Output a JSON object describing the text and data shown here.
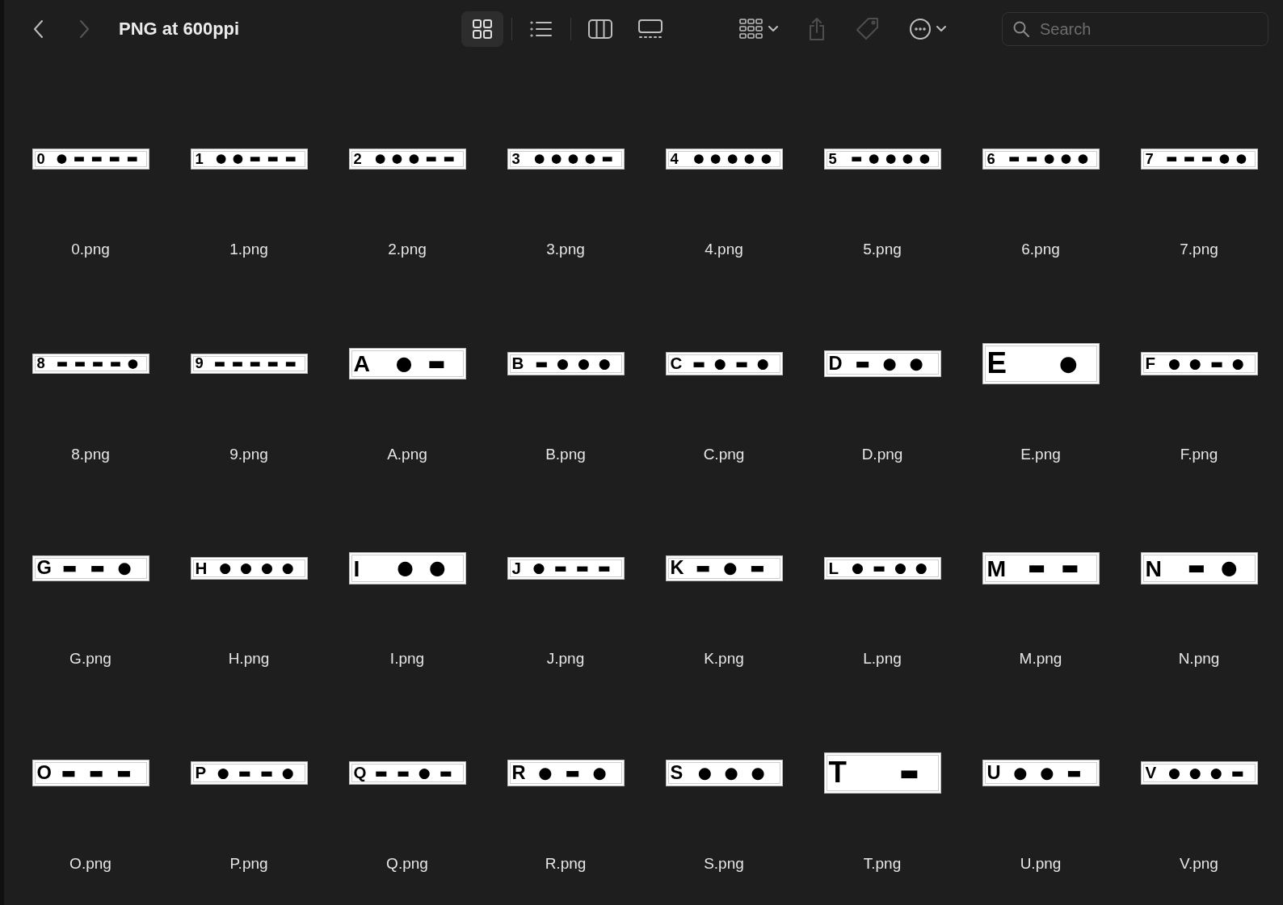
{
  "window": {
    "title": "PNG at 600ppi"
  },
  "navigation": [
    {
      "kind": "back",
      "disabled": false
    },
    {
      "kind": "forward",
      "disabled": true
    }
  ],
  "view_modes": [
    {
      "kind": "icons",
      "selected": true
    },
    {
      "kind": "list",
      "selected": false
    },
    {
      "kind": "columns",
      "selected": false
    },
    {
      "kind": "gallery",
      "selected": false
    }
  ],
  "toolbar_buttons": [
    {
      "kind": "group",
      "disabled": false
    },
    {
      "kind": "share",
      "disabled": true
    },
    {
      "kind": "tags",
      "disabled": true
    },
    {
      "kind": "more",
      "disabled": false
    }
  ],
  "search": {
    "placeholder": "Search"
  },
  "files": [
    {
      "name": "0.png",
      "thumbnail": {
        "char": "0",
        "code": "●▬▬▬▬"
      }
    },
    {
      "name": "1.png",
      "thumbnail": {
        "char": "1",
        "code": "●●▬▬▬"
      }
    },
    {
      "name": "2.png",
      "thumbnail": {
        "char": "2",
        "code": "●●●▬▬"
      }
    },
    {
      "name": "3.png",
      "thumbnail": {
        "char": "3",
        "code": "●●●●▬"
      }
    },
    {
      "name": "4.png",
      "thumbnail": {
        "char": "4",
        "code": "●●●●●"
      }
    },
    {
      "name": "5.png",
      "thumbnail": {
        "char": "5",
        "code": "▬●●●●"
      }
    },
    {
      "name": "6.png",
      "thumbnail": {
        "char": "6",
        "code": "▬▬●●●"
      }
    },
    {
      "name": "7.png",
      "thumbnail": {
        "char": "7",
        "code": "▬▬▬●●"
      }
    },
    {
      "name": "8.png",
      "thumbnail": {
        "char": "8",
        "code": "▬▬▬▬●"
      }
    },
    {
      "name": "9.png",
      "thumbnail": {
        "char": "9",
        "code": "▬▬▬▬▬"
      }
    },
    {
      "name": "A.png",
      "thumbnail": {
        "char": "A",
        "code": "●▬"
      }
    },
    {
      "name": "B.png",
      "thumbnail": {
        "char": "B",
        "code": "▬●●●"
      }
    },
    {
      "name": "C.png",
      "thumbnail": {
        "char": "C",
        "code": "▬●▬●"
      }
    },
    {
      "name": "D.png",
      "thumbnail": {
        "char": "D",
        "code": "▬●●"
      }
    },
    {
      "name": "E.png",
      "thumbnail": {
        "char": "E",
        "code": "●"
      }
    },
    {
      "name": "F.png",
      "thumbnail": {
        "char": "F",
        "code": "●●▬●"
      }
    },
    {
      "name": "G.png",
      "thumbnail": {
        "char": "G",
        "code": "▬▬●"
      }
    },
    {
      "name": "H.png",
      "thumbnail": {
        "char": "H",
        "code": "●●●●"
      }
    },
    {
      "name": "I.png",
      "thumbnail": {
        "char": "I",
        "code": "●●"
      }
    },
    {
      "name": "J.png",
      "thumbnail": {
        "char": "J",
        "code": "●▬▬▬"
      }
    },
    {
      "name": "K.png",
      "thumbnail": {
        "char": "K",
        "code": "▬●▬"
      }
    },
    {
      "name": "L.png",
      "thumbnail": {
        "char": "L",
        "code": "●▬●●"
      }
    },
    {
      "name": "M.png",
      "thumbnail": {
        "char": "M",
        "code": "▬▬"
      }
    },
    {
      "name": "N.png",
      "thumbnail": {
        "char": "N",
        "code": "▬●"
      }
    },
    {
      "name": "O.png",
      "thumbnail": {
        "char": "O",
        "code": "▬▬▬"
      }
    },
    {
      "name": "P.png",
      "thumbnail": {
        "char": "P",
        "code": "●▬▬●"
      }
    },
    {
      "name": "Q.png",
      "thumbnail": {
        "char": "Q",
        "code": "▬▬●▬"
      }
    },
    {
      "name": "R.png",
      "thumbnail": {
        "char": "R",
        "code": "●▬●"
      }
    },
    {
      "name": "S.png",
      "thumbnail": {
        "char": "S",
        "code": "●●●"
      }
    },
    {
      "name": "T.png",
      "thumbnail": {
        "char": "T",
        "code": "▬"
      }
    },
    {
      "name": "U.png",
      "thumbnail": {
        "char": "U",
        "code": "●●▬"
      }
    },
    {
      "name": "V.png",
      "thumbnail": {
        "char": "V",
        "code": "●●●▬"
      }
    }
  ]
}
